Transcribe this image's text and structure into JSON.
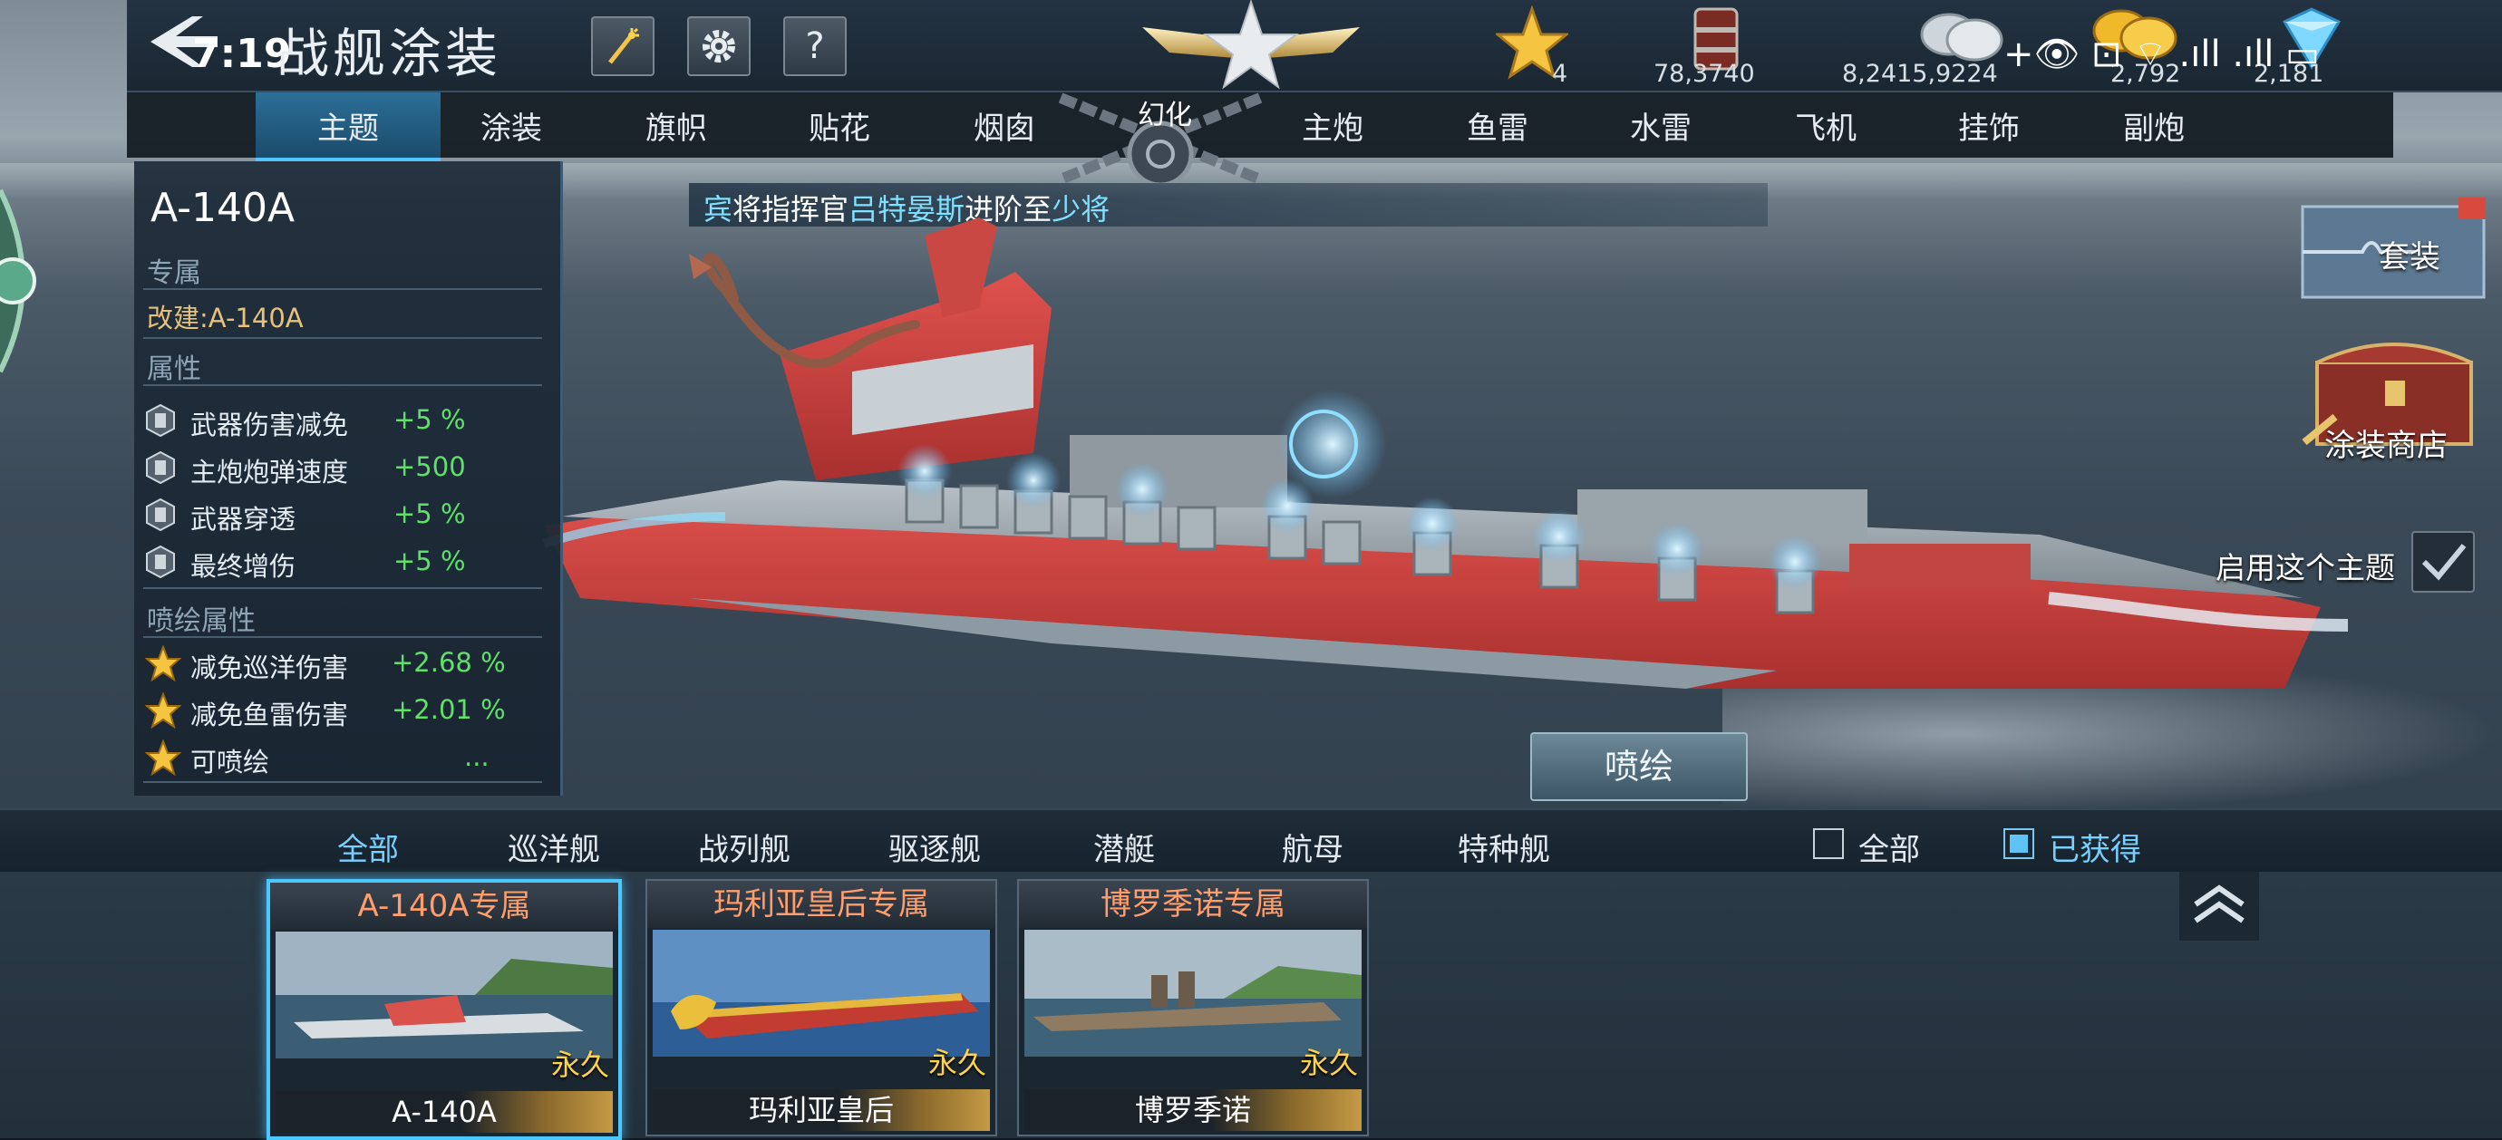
{
  "status_bar": {
    "time": "7:19",
    "indicators": "+👁 ⊡ ⌔ .ıll .ıll ▭"
  },
  "header": {
    "title": "战舰涂装",
    "icons": [
      "back-arrow-icon",
      "fireworks-icon",
      "gear-icon",
      "help-icon"
    ],
    "help_label": "?",
    "resources": [
      {
        "icon": "gold-star-icon",
        "value": "4"
      },
      {
        "icon": "oil-barrel-icon",
        "value": "78,3740"
      },
      {
        "icon": "silver-coin-icon",
        "value": "8,2415,9224"
      },
      {
        "icon": "gold-coin-icon",
        "value": "2,792"
      },
      {
        "icon": "diamond-icon",
        "value": "2,181"
      }
    ]
  },
  "tabs": [
    {
      "label": "主题",
      "active": true
    },
    {
      "label": "涂装"
    },
    {
      "label": "旗帜"
    },
    {
      "label": "贴花"
    },
    {
      "label": "烟囱"
    },
    {
      "label": "幻化"
    },
    {
      "label": "主炮"
    },
    {
      "label": "鱼雷"
    },
    {
      "label": "水雷"
    },
    {
      "label": "飞机"
    },
    {
      "label": "挂饰"
    },
    {
      "label": "副炮"
    }
  ],
  "notice": {
    "prefix": "宾",
    "part1": "将指挥官",
    "name": "吕特晏斯",
    "part2": "进阶至",
    "rank": "少将"
  },
  "info_panel": {
    "ship_name": "A-140A",
    "exclusive_label": "专属",
    "refit_text": "改建:A-140A",
    "attributes_label": "属性",
    "attributes": [
      {
        "name": "武器伤害减免",
        "value": "+5 %"
      },
      {
        "name": "主炮炮弹速度",
        "value": "+500"
      },
      {
        "name": "武器穿透",
        "value": "+5 %"
      },
      {
        "name": "最终增伤",
        "value": "+5 %"
      }
    ],
    "spray_attributes_label": "喷绘属性",
    "spray_attributes": [
      {
        "name": "减免巡洋伤害",
        "value": "+2.68 %"
      },
      {
        "name": "减免鱼雷伤害",
        "value": "+2.01 %"
      },
      {
        "name": "可喷绘",
        "value": "..."
      }
    ]
  },
  "right_side": {
    "set_label": "套装",
    "shop_label": "涂装商店",
    "enable_theme_label": "启用这个主题",
    "spray_button": "喷绘"
  },
  "category_filters": [
    {
      "label": "全部",
      "active": true
    },
    {
      "label": "巡洋舰"
    },
    {
      "label": "战列舰"
    },
    {
      "label": "驱逐舰"
    },
    {
      "label": "潜艇"
    },
    {
      "label": "航母"
    },
    {
      "label": "特种舰"
    }
  ],
  "checkboxes": [
    {
      "label": "全部",
      "checked": false
    },
    {
      "label": "已获得",
      "checked": true
    }
  ],
  "skins": [
    {
      "title": "A-140A专属",
      "duration": "永久",
      "ship": "A-140A",
      "selected": true
    },
    {
      "title": "玛利亚皇后专属",
      "duration": "永久",
      "ship": "玛利亚皇后",
      "selected": false
    },
    {
      "title": "博罗季诺专属",
      "duration": "永久",
      "ship": "博罗季诺",
      "selected": false
    }
  ],
  "colors": {
    "accent": "#4cc7ff",
    "positive_value": "#5ee06a",
    "gold": "#ffd24a",
    "skin_title": "#ff9e6c"
  }
}
